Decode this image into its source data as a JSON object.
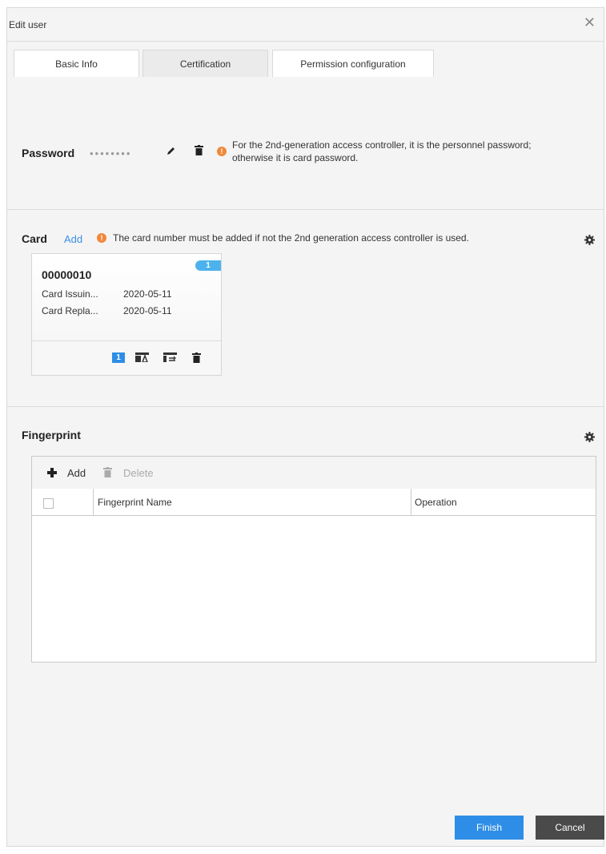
{
  "dialog": {
    "title": "Edit user"
  },
  "tabs": [
    {
      "label": "Basic Info"
    },
    {
      "label": "Certification"
    },
    {
      "label": "Permission configuration"
    }
  ],
  "password": {
    "label": "Password",
    "masked_value": "••••••••",
    "note_line1": "For the 2nd-generation access controller, it is the personnel password;",
    "note_line2": "otherwise it is card password."
  },
  "card_section": {
    "label": "Card",
    "add_link": "Add",
    "note": "The card number must be added if not the 2nd generation access controller is used.",
    "card": {
      "number": "00000010",
      "badge": "1",
      "issuing_label": "Card Issuin...",
      "issuing_date": "2020-05-11",
      "replace_label": "Card Repla...",
      "replace_date": "2020-05-11",
      "main_card_tag": "1"
    }
  },
  "fingerprint": {
    "label": "Fingerprint",
    "toolbar": {
      "add_label": "Add",
      "delete_label": "Delete"
    },
    "columns": [
      "Fingerprint Name",
      "Operation"
    ],
    "rows": []
  },
  "footer": {
    "finish_label": "Finish",
    "cancel_label": "Cancel"
  },
  "colors": {
    "accent": "#2e8de6",
    "cancel": "#4a4a4a",
    "warning": "#f0883a",
    "badge": "#4cb2ee"
  }
}
